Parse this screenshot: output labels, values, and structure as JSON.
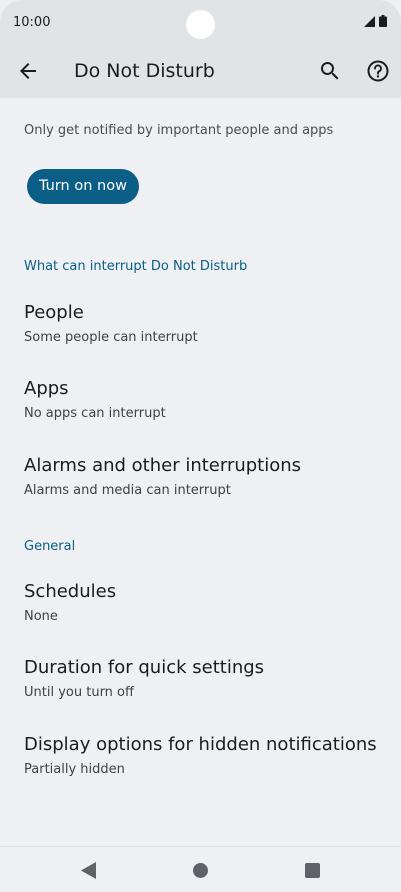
{
  "status_bar": {
    "time": "10:00"
  },
  "app_bar": {
    "title": "Do Not Disturb"
  },
  "intro": {
    "description": "Only get notified by important people and apps",
    "turn_on_label": "Turn on now"
  },
  "sections": [
    {
      "header": "What can interrupt Do Not Disturb",
      "items": [
        {
          "title": "People",
          "subtitle": "Some people can interrupt"
        },
        {
          "title": "Apps",
          "subtitle": "No apps can interrupt"
        },
        {
          "title": "Alarms and other interruptions",
          "subtitle": "Alarms and media can interrupt"
        }
      ]
    },
    {
      "header": "General",
      "items": [
        {
          "title": "Schedules",
          "subtitle": "None"
        },
        {
          "title": "Duration for quick settings",
          "subtitle": "Until you turn off"
        },
        {
          "title": "Display options for hidden notifications",
          "subtitle": "Partially hidden"
        }
      ]
    }
  ],
  "icons": {
    "back": "arrow-back-icon",
    "search": "search-icon",
    "help": "help-icon",
    "signal": "signal-icon",
    "battery": "battery-icon",
    "nav_back": "nav-back-icon",
    "nav_home": "nav-home-icon",
    "nav_recent": "nav-recent-icon"
  },
  "colors": {
    "accent": "#0b5e86",
    "background": "#eef0f3",
    "app_bar": "#e2e3e6"
  }
}
